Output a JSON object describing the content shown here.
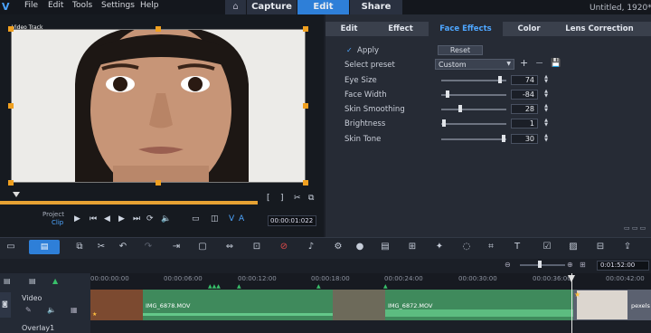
{
  "app": {
    "title": "Untitled, 1920*10",
    "menus": [
      "File",
      "Edit",
      "Tools",
      "Settings",
      "Help"
    ],
    "mode_tabs": [
      "Capture",
      "Edit",
      "Share"
    ],
    "active_mode": "Edit"
  },
  "preview": {
    "track_label": "Video Track",
    "project_label": "Project",
    "clip_label": "Clip",
    "timecode": "00:00:01:022"
  },
  "effects_panel": {
    "tabs": [
      "Edit",
      "Effect",
      "Face Effects",
      "Color",
      "Lens Correction"
    ],
    "active_tab": "Face Effects",
    "apply_label": "Apply",
    "apply_checked": true,
    "reset_label": "Reset",
    "preset_label": "Select preset",
    "preset_value": "Custom",
    "sliders": [
      {
        "label": "Eye Size",
        "value": "74",
        "level": 0.92
      },
      {
        "label": "Face Width",
        "value": "-84",
        "level": 0.08
      },
      {
        "label": "Skin Smoothing",
        "value": "28",
        "level": 0.28
      },
      {
        "label": "Brightness",
        "value": "1",
        "level": 0.01
      },
      {
        "label": "Skin Tone",
        "value": "30",
        "level": 0.98
      }
    ]
  },
  "timeline": {
    "ruler": [
      "00:00:00:00",
      "00:00:06:00",
      "00:00:12:00",
      "00:00:18:00",
      "00:00:24:00",
      "00:00:30:00",
      "00:00:36:00",
      "00:00:42:00"
    ],
    "zoom_time": "0:01:52:00",
    "tracks": [
      "Video",
      "Overlay1"
    ],
    "clips": [
      "IMG_6878.MOV",
      "IMG_6872.MOV",
      "pexels"
    ]
  },
  "colors": {
    "accent": "#2e7fd8",
    "handle": "#f0a020",
    "clip": "#3f8a5c"
  }
}
